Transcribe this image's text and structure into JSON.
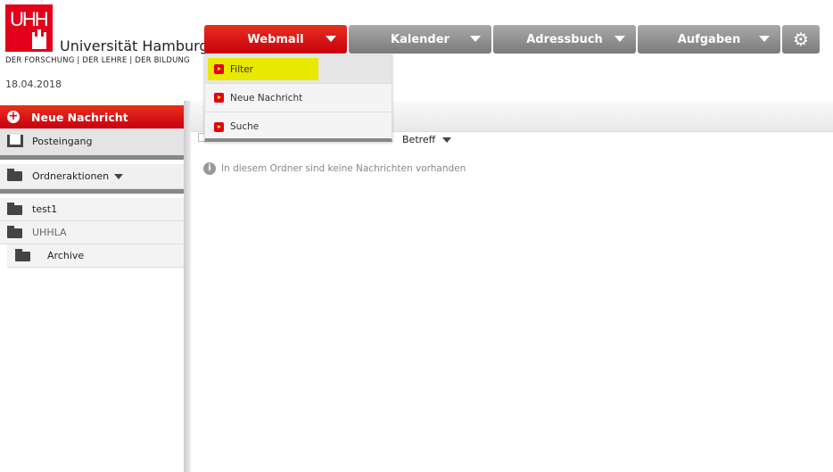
{
  "brand": {
    "logo_text": "UHH",
    "name": "Universität Hamburg",
    "tagline": "DER FORSCHUNG | DER LEHRE | DER BILDUNG",
    "date": "18.04.2018",
    "color": "#e2001a"
  },
  "nav": [
    {
      "label": "Webmail",
      "active": true
    },
    {
      "label": "Kalender"
    },
    {
      "label": "Adressbuch"
    },
    {
      "label": "Aufgaben"
    }
  ],
  "settings_icon": "gear-icon",
  "menu": [
    {
      "label": "Filter",
      "hover": true
    },
    {
      "label": "Neue Nachricht"
    },
    {
      "label": "Suche"
    }
  ],
  "sidebar": {
    "new_message": "Neue Nachricht",
    "inbox": "Posteingang",
    "folder_actions": "Ordneraktionen",
    "folders": [
      {
        "label": "test1"
      },
      {
        "label": "UHHLA"
      },
      {
        "label": "Archive"
      }
    ]
  },
  "main": {
    "sort_label": "Betreff",
    "empty_message": "In diesem Ordner sind keine Nachrichten vorhanden"
  }
}
